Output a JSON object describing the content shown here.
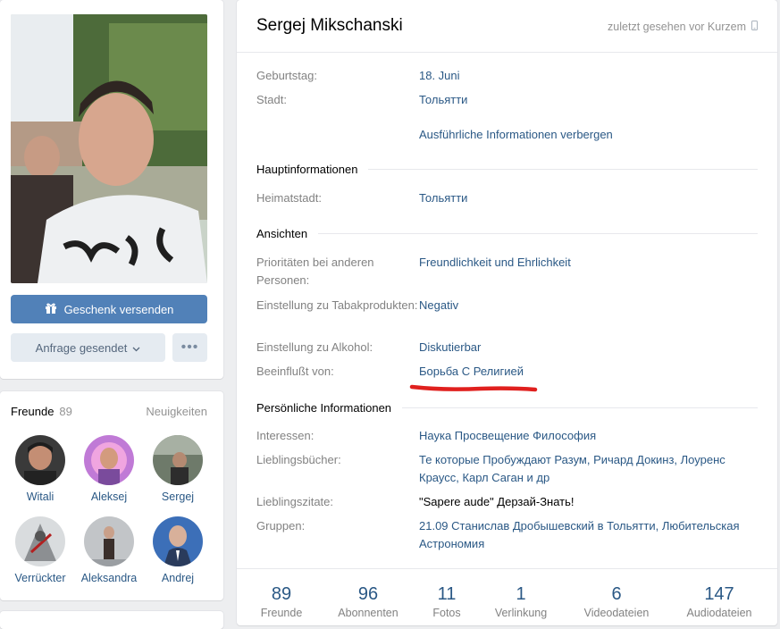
{
  "profile": {
    "name": "Sergej Mikschanski",
    "last_seen": "zuletzt gesehen vor Kurzem"
  },
  "actions": {
    "gift": "Geschenk versenden",
    "request": "Anfrage gesendet",
    "more": "•••"
  },
  "info": {
    "birthday_label": "Geburtstag:",
    "birthday_value": "18. Juni",
    "city_label": "Stadt:",
    "city_value": "Тольятти",
    "toggle_details": "Ausführliche Informationen verbergen"
  },
  "sections": {
    "main": "Hauptinformationen",
    "views": "Ansichten",
    "personal": "Persönliche Informationen"
  },
  "main_info": {
    "hometown_label": "Heimatstadt:",
    "hometown_value": "Тольятти"
  },
  "views": {
    "priorities_label": "Prioritäten bei anderen Personen:",
    "priorities_value": "Freundlichkeit und Ehrlichkeit",
    "smoking_label": "Einstellung zu Tabakprodukten:",
    "smoking_value": "Negativ",
    "alcohol_label": "Einstellung zu Alkohol:",
    "alcohol_value": "Diskutierbar",
    "influenced_label": "Beeinflußt von:",
    "influenced_value": "Борьба С Религией"
  },
  "personal": {
    "interests_label": "Interessen:",
    "interests_value": "Наука Просвещение Философия",
    "books_label": "Lieblingsbücher:",
    "books_value": "Те которые Пробуждают Разум, Ричард Докинз, Лоуренс Краусс, Карл Саган и др",
    "quotes_label": "Lieblingszitate:",
    "quotes_value": "\"Sapere aude\" Дерзай-Знать!",
    "groups_label": "Gruppen:",
    "groups_value": "21.09 Станислав Дробышевский в Тольятти, Любительская Астрономия"
  },
  "friends": {
    "title": "Freunde",
    "count": "89",
    "news": "Neuigkeiten",
    "items": [
      {
        "name": "Witali"
      },
      {
        "name": "Aleksej"
      },
      {
        "name": "Sergej"
      },
      {
        "name": "Verrückter"
      },
      {
        "name": "Aleksandra"
      },
      {
        "name": "Andrej"
      }
    ]
  },
  "counters": [
    {
      "number": "89",
      "label": "Freunde"
    },
    {
      "number": "96",
      "label": "Abonnenten"
    },
    {
      "number": "11",
      "label": "Fotos"
    },
    {
      "number": "1",
      "label": "Verlinkung"
    },
    {
      "number": "6",
      "label": "Videodateien"
    },
    {
      "number": "147",
      "label": "Audiodateien"
    }
  ],
  "colors": {
    "accent": "#5181b8",
    "link": "#2a5885",
    "label": "#828282",
    "background": "#edeef0",
    "annotation": "#e0201e"
  }
}
